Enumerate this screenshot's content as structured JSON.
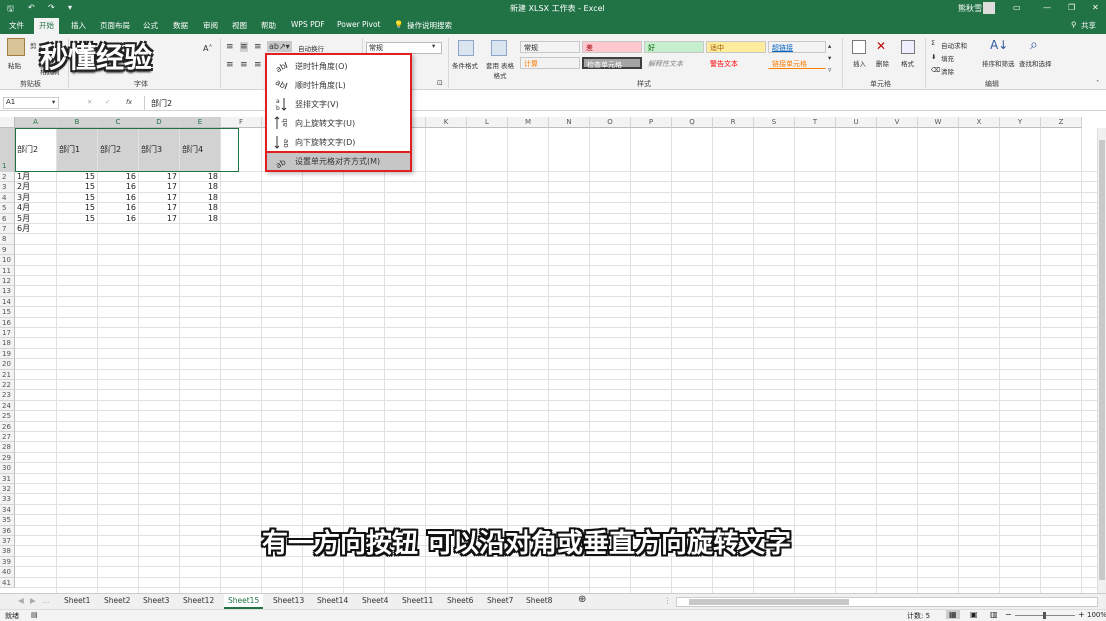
{
  "title": {
    "doc": "新建 XLSX 工作表 - Excel",
    "user": "熊秋雪"
  },
  "ribbon_tabs": [
    "文件",
    "开始",
    "插入",
    "页面布局",
    "公式",
    "数据",
    "审阅",
    "视图",
    "帮助",
    "WPS PDF",
    "Power Pivot"
  ],
  "tell_me": "操作说明搜索",
  "share": "共享",
  "ribbon": {
    "clipboard": "剪贴板",
    "paste": "粘贴",
    "cut": "剪",
    "copy": "复制",
    "format_painter": "格式刷",
    "font": "字体",
    "wrap": "自动换行",
    "number_format": "常规",
    "cond_format": "条件格式",
    "table_format": "套用\n表格格式",
    "styles": "样式",
    "insert": "插入",
    "delete": "删除",
    "format": "格式",
    "cells": "单元格",
    "autosum": "自动求和",
    "fill": "填充",
    "clear": "清除",
    "sort": "排序和筛选",
    "find": "查找和选择",
    "editing": "编辑",
    "style_boxes": [
      {
        "label": "常规",
        "bg": "#ffffff",
        "color": "#000000"
      },
      {
        "label": "差",
        "bg": "#ffc7ce",
        "color": "#9c0006"
      },
      {
        "label": "好",
        "bg": "#c6efce",
        "color": "#006100"
      },
      {
        "label": "适中",
        "bg": "#ffeb9c",
        "color": "#9c5700"
      },
      {
        "label": "超链接",
        "bg": "#ffffff",
        "color": "#0563c1"
      },
      {
        "label": "计算",
        "bg": "#f2f2f2",
        "color": "#fa7d00"
      },
      {
        "label": "检查单元格",
        "bg": "#a5a5a5",
        "color": "#ffffff"
      },
      {
        "label": "解释性文本",
        "bg": "#ffffff",
        "color": "#7f7f7f"
      },
      {
        "label": "警告文本",
        "bg": "#ffffff",
        "color": "#ff0000"
      },
      {
        "label": "链接单元格",
        "bg": "#ffffff",
        "color": "#fa7d00"
      }
    ]
  },
  "formula_bar": {
    "name_box": "A1",
    "fx": "fx",
    "value": "部门2"
  },
  "columns": [
    "A",
    "B",
    "C",
    "D",
    "E",
    "F",
    "G",
    "H",
    "I",
    "J",
    "K",
    "L",
    "M",
    "N",
    "O",
    "P",
    "Q",
    "R",
    "S",
    "T",
    "U",
    "V",
    "W",
    "X",
    "Y",
    "Z"
  ],
  "header_row": [
    "部门2",
    "部门1",
    "部门2",
    "部门3",
    "部门4"
  ],
  "data_rows": [
    {
      "month": "1月",
      "v": [
        "15",
        "16",
        "17",
        "18"
      ]
    },
    {
      "month": "2月",
      "v": [
        "15",
        "16",
        "17",
        "18"
      ]
    },
    {
      "month": "3月",
      "v": [
        "15",
        "16",
        "17",
        "18"
      ]
    },
    {
      "month": "4月",
      "v": [
        "15",
        "16",
        "17",
        "18"
      ]
    },
    {
      "month": "5月",
      "v": [
        "15",
        "16",
        "17",
        "18"
      ]
    },
    {
      "month": "6月",
      "v": [
        "",
        "",
        "",
        ""
      ]
    }
  ],
  "menu": [
    "逆时针角度(O)",
    "顺时针角度(L)",
    "竖排文字(V)",
    "向上旋转文字(U)",
    "向下旋转文字(D)",
    "设置单元格对齐方式(M)"
  ],
  "sheets": [
    "Sheet1",
    "Sheet2",
    "Sheet3",
    "Sheet12",
    "Sheet15",
    "Sheet13",
    "Sheet14",
    "Sheet4",
    "Sheet11",
    "Sheet6",
    "Sheet7",
    "Sheet8"
  ],
  "active_sheet": "Sheet15",
  "status": {
    "ready": "就绪",
    "count": "计数: 5",
    "zoom": "100%"
  },
  "subtitle": "有一方向按钮 可以沿对角或垂直方向旋转文字",
  "watermark": "秒懂经验"
}
